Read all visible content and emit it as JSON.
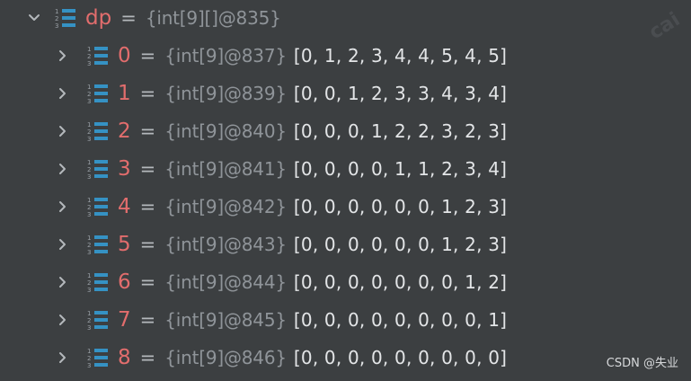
{
  "root": {
    "name": "dp",
    "eq": "=",
    "ref": "{int[9][]@835}"
  },
  "items": [
    {
      "index": "0",
      "eq": "=",
      "ref": "{int[9]@837}",
      "values": "[0, 1, 2, 3, 4, 4, 5, 4, 5]"
    },
    {
      "index": "1",
      "eq": "=",
      "ref": "{int[9]@839}",
      "values": "[0, 0, 1, 2, 3, 3, 4, 3, 4]"
    },
    {
      "index": "2",
      "eq": "=",
      "ref": "{int[9]@840}",
      "values": "[0, 0, 0, 1, 2, 2, 3, 2, 3]"
    },
    {
      "index": "3",
      "eq": "=",
      "ref": "{int[9]@841}",
      "values": "[0, 0, 0, 0, 1, 1, 2, 3, 4]"
    },
    {
      "index": "4",
      "eq": "=",
      "ref": "{int[9]@842}",
      "values": "[0, 0, 0, 0, 0, 0, 1, 2, 3]"
    },
    {
      "index": "5",
      "eq": "=",
      "ref": "{int[9]@843}",
      "values": "[0, 0, 0, 0, 0, 0, 1, 2, 3]"
    },
    {
      "index": "6",
      "eq": "=",
      "ref": "{int[9]@844}",
      "values": "[0, 0, 0, 0, 0, 0, 0, 1, 2]"
    },
    {
      "index": "7",
      "eq": "=",
      "ref": "{int[9]@845}",
      "values": "[0, 0, 0, 0, 0, 0, 0, 0, 1]"
    },
    {
      "index": "8",
      "eq": "=",
      "ref": "{int[9]@846}",
      "values": "[0, 0, 0, 0, 0, 0, 0, 0, 0]"
    }
  ],
  "watermark": "cai",
  "credit": "CSDN @失业",
  "colors": {
    "background": "#3c3f41",
    "name": "#e26d6d",
    "reference": "#8f9499",
    "values": "#e3e5e7",
    "icon": "#3592c4"
  }
}
